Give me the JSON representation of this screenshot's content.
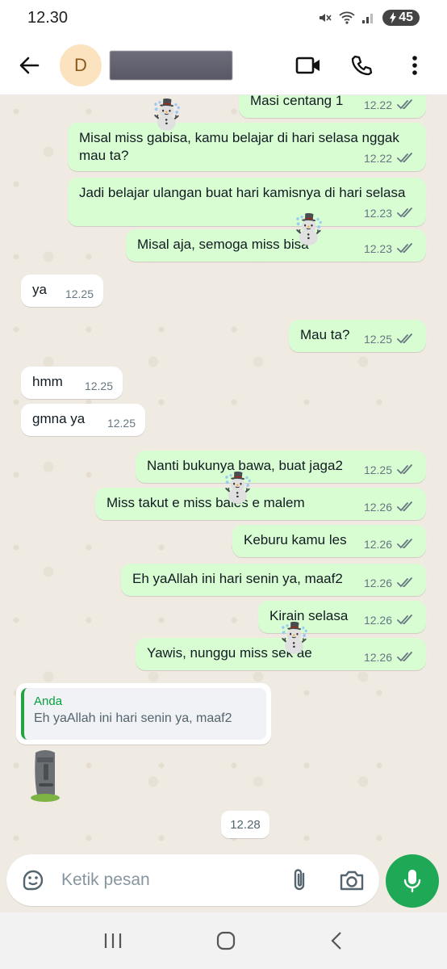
{
  "status_bar": {
    "time": "12.30",
    "battery": "45"
  },
  "header": {
    "avatar_letter": "D"
  },
  "messages": [
    {
      "text": "Masi centang 1",
      "time": "12.22",
      "dir": "out"
    },
    {
      "text": "Misal miss gabisa, kamu belajar di hari selasa nggak mau ta?",
      "time": "12.22",
      "dir": "out"
    },
    {
      "text": "Jadi belajar ulangan buat hari kamisnya di hari selasa",
      "time": "12.23",
      "dir": "out"
    },
    {
      "text": "Misal aja, semoga miss bisa",
      "time": "12.23",
      "dir": "out"
    },
    {
      "text": "ya",
      "time": "12.25",
      "dir": "in"
    },
    {
      "text": "Mau ta?",
      "time": "12.25",
      "dir": "out"
    },
    {
      "text": "hmm",
      "time": "12.25",
      "dir": "in"
    },
    {
      "text": "gmna ya",
      "time": "12.25",
      "dir": "in"
    },
    {
      "text": "Nanti bukunya bawa, buat jaga2",
      "time": "12.25",
      "dir": "out"
    },
    {
      "text": "Miss takut e miss bales e malem",
      "time": "12.26",
      "dir": "out"
    },
    {
      "text": "Keburu kamu les",
      "time": "12.26",
      "dir": "out"
    },
    {
      "text": "Eh yaAllah ini hari senin ya, maaf2",
      "time": "12.26",
      "dir": "out"
    },
    {
      "text": "Kirain selasa",
      "time": "12.26",
      "dir": "out"
    },
    {
      "text": "Yawis, nunggu miss sek ae",
      "time": "12.26",
      "dir": "out"
    }
  ],
  "reply": {
    "author": "Anda",
    "quoted_text": "Eh yaAllah ini hari senin ya, maaf2"
  },
  "sticker": {
    "icon": "moai-sticker"
  },
  "last_time": "12.28",
  "composer": {
    "placeholder": "Ketik pesan"
  },
  "colors": {
    "outgoing_bubble": "#d9fdd3",
    "incoming_bubble": "#ffffff",
    "accent": "#1fa855",
    "ticks": "#667781"
  }
}
